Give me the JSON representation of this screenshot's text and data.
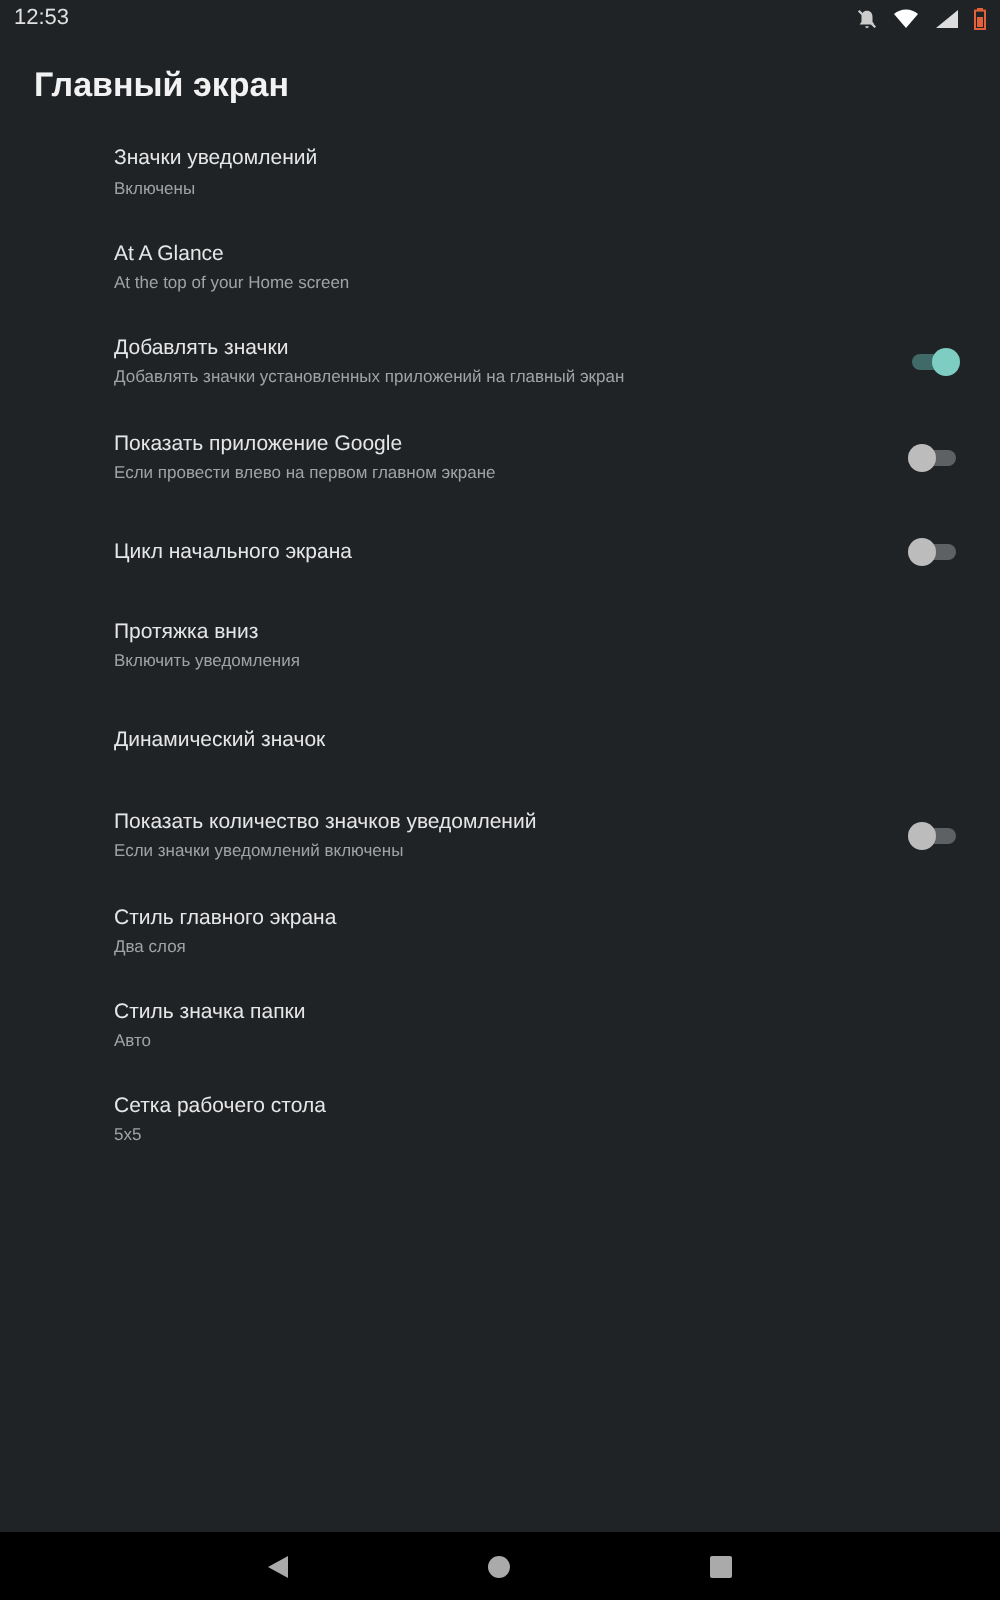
{
  "status_bar": {
    "time": "12:53"
  },
  "header": {
    "title": "Главный экран"
  },
  "settings": [
    {
      "kind": "plain",
      "title": "Значки уведомлений",
      "subtitle": "Включены"
    },
    {
      "kind": "plain",
      "title": "At A Glance",
      "subtitle": "At the top of your Home screen"
    },
    {
      "kind": "switch",
      "title": "Добавлять значки",
      "subtitle": "Добавлять значки установленных приложений на главный экран",
      "on": true
    },
    {
      "kind": "switch",
      "title": "Показать приложение Google",
      "subtitle": "Если провести влево на первом главном экране",
      "on": false
    },
    {
      "kind": "switch",
      "title": "Цикл начального экрана",
      "on": false
    },
    {
      "kind": "plain",
      "title": "Протяжка вниз",
      "subtitle": "Включить уведомления"
    },
    {
      "kind": "plain",
      "title": "Динамический значок"
    },
    {
      "kind": "switch",
      "title": "Показать количество значков уведомлений",
      "subtitle": "Если значки уведомлений включены",
      "on": false
    },
    {
      "kind": "plain",
      "title": "Стиль главного экрана",
      "subtitle": "Два слоя"
    },
    {
      "kind": "plain",
      "title": "Стиль значка папки",
      "subtitle": "Авто"
    },
    {
      "kind": "plain",
      "title": "Сетка рабочего стола",
      "subtitle": "5x5"
    }
  ]
}
